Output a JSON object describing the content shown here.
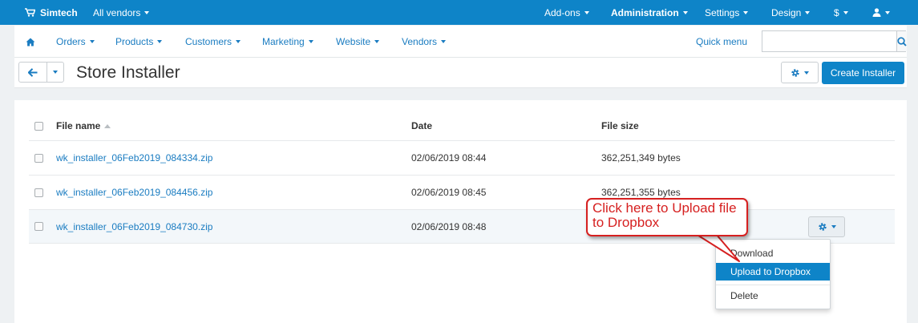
{
  "topbar": {
    "store_name": "Simtech",
    "vendor_select": "All vendors",
    "addons": "Add-ons",
    "administration": "Administration",
    "settings": "Settings",
    "design": "Design",
    "currency": "$"
  },
  "nav": {
    "orders": "Orders",
    "products": "Products",
    "customers": "Customers",
    "marketing": "Marketing",
    "website": "Website",
    "vendors": "Vendors",
    "quick_menu": "Quick menu",
    "search_placeholder": ""
  },
  "title": {
    "page_title": "Store Installer",
    "create_button": "Create Installer"
  },
  "table": {
    "headers": {
      "file_name": "File name",
      "date": "Date",
      "file_size": "File size"
    },
    "rows": [
      {
        "file_name": "wk_installer_06Feb2019_084334.zip",
        "date": "02/06/2019 08:44",
        "size": "362,251,349 bytes"
      },
      {
        "file_name": "wk_installer_06Feb2019_084456.zip",
        "date": "02/06/2019 08:45",
        "size": "362,251,355 bytes"
      },
      {
        "file_name": "wk_installer_06Feb2019_084730.zip",
        "date": "02/06/2019 08:48",
        "size": ""
      }
    ]
  },
  "dropdown": {
    "download": "Download",
    "upload_dropbox": "Upload to Dropbox",
    "delete": "Delete"
  },
  "callout": {
    "text": "Click here to Upload file to Dropbox"
  },
  "colors": {
    "brand_blue": "#0e84c8",
    "link_blue": "#1a7cc1",
    "callout_red": "#d62020"
  },
  "icons": {
    "cart": "cart-icon",
    "home": "home-icon",
    "search": "search-icon",
    "back": "arrow-left-icon",
    "gear": "gear-icon",
    "user": "user-icon"
  }
}
